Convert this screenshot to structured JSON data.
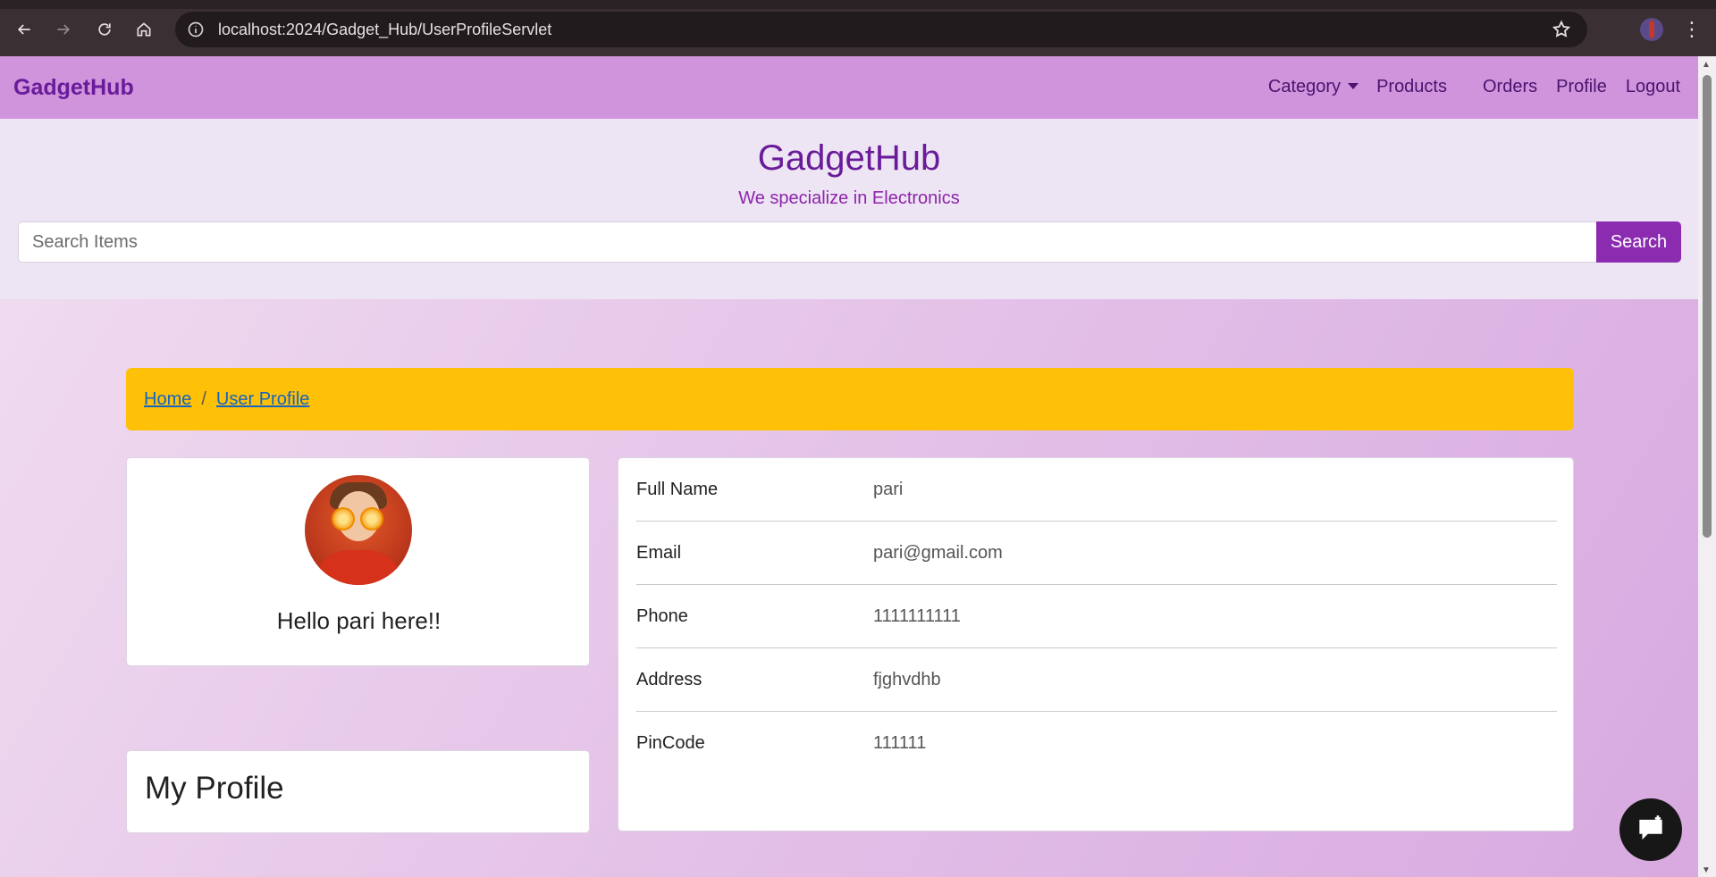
{
  "browser": {
    "url": "localhost:2024/Gadget_Hub/UserProfileServlet",
    "icons": [
      "back-arrow-icon",
      "forward-arrow-icon",
      "reload-icon",
      "home-icon",
      "site-info-icon",
      "bookmark-star-icon",
      "profile-avatar-icon",
      "menu-kebab-icon"
    ]
  },
  "navbar": {
    "brand": "GadgetHub",
    "links": {
      "category": "Category",
      "products": "Products",
      "orders": "Orders",
      "profile": "Profile",
      "logout": "Logout"
    },
    "color": "#cf94dc"
  },
  "hero": {
    "title": "GadgetHub",
    "subtitle": "We specialize in Electronics",
    "search": {
      "placeholder": "Search Items",
      "button_label": "Search"
    }
  },
  "breadcrumb": {
    "home": "Home",
    "separator": "/",
    "current": "User Profile",
    "color": "#ffc107"
  },
  "profile_card": {
    "greeting": "Hello pari here!!",
    "section_title": "My Profile"
  },
  "details": {
    "rows": [
      {
        "label": "Full Name",
        "value": "pari"
      },
      {
        "label": "Email",
        "value": "pari@gmail.com"
      },
      {
        "label": "Phone",
        "value": "1111111111"
      },
      {
        "label": "Address",
        "value": "fjghvdhb"
      },
      {
        "label": "PinCode",
        "value": "111111"
      }
    ]
  },
  "colors": {
    "accent": "#8b2cb0",
    "brand_text": "#6a1b9a"
  }
}
